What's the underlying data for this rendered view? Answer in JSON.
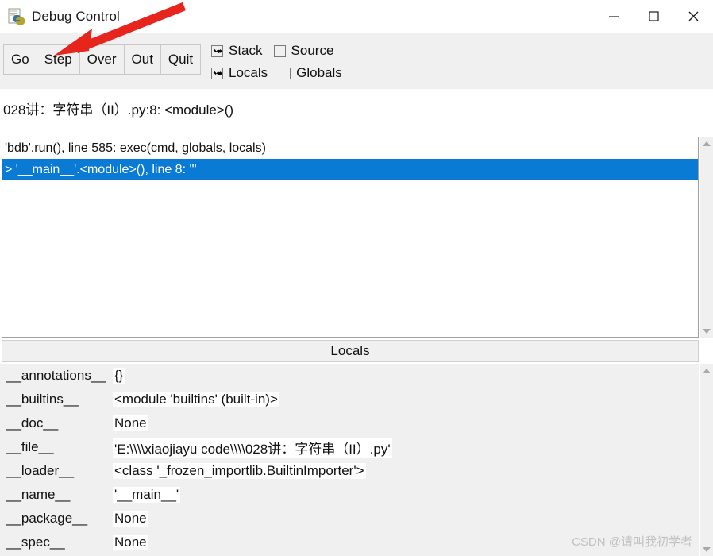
{
  "window": {
    "title": "Debug Control",
    "icon": "python-file-icon",
    "controls": {
      "minimize": "minimize-icon",
      "maximize": "maximize-icon",
      "close": "close-icon"
    }
  },
  "toolbar": {
    "buttons": [
      "Go",
      "Step",
      "Over",
      "Out",
      "Quit"
    ],
    "checkboxes": [
      {
        "label": "Stack",
        "checked": true
      },
      {
        "label": "Source",
        "checked": false
      },
      {
        "label": "Locals",
        "checked": true
      },
      {
        "label": "Globals",
        "checked": false
      }
    ]
  },
  "status_line": "028讲：字符串（II）.py:8: <module>()",
  "stack": {
    "rows": [
      {
        "text": "'bdb'.run(), line 585: exec(cmd, globals, locals)",
        "selected": false
      },
      {
        "text": "> '__main__'.<module>(), line 8: '''",
        "selected": true
      }
    ]
  },
  "locals": {
    "header": "Locals",
    "rows": [
      {
        "name": "__annotations__",
        "value": "{}"
      },
      {
        "name": "__builtins__",
        "value": "<module 'builtins' (built-in)>"
      },
      {
        "name": "__doc__",
        "value": "None"
      },
      {
        "name": "__file__",
        "value": "'E:\\\\\\\\xiaojiayu code\\\\\\\\028讲：字符串（II）.py'"
      },
      {
        "name": "__loader__",
        "value": "<class '_frozen_importlib.BuiltinImporter'>"
      },
      {
        "name": "__name__",
        "value": "'__main__'"
      },
      {
        "name": "__package__",
        "value": "None"
      },
      {
        "name": "__spec__",
        "value": "None"
      }
    ]
  },
  "watermark": "CSDN @请叫我初学者",
  "colors": {
    "selection": "#0a7bd4",
    "annotation_arrow": "#e8251c",
    "toolbar_bg": "#f0f0f0"
  }
}
